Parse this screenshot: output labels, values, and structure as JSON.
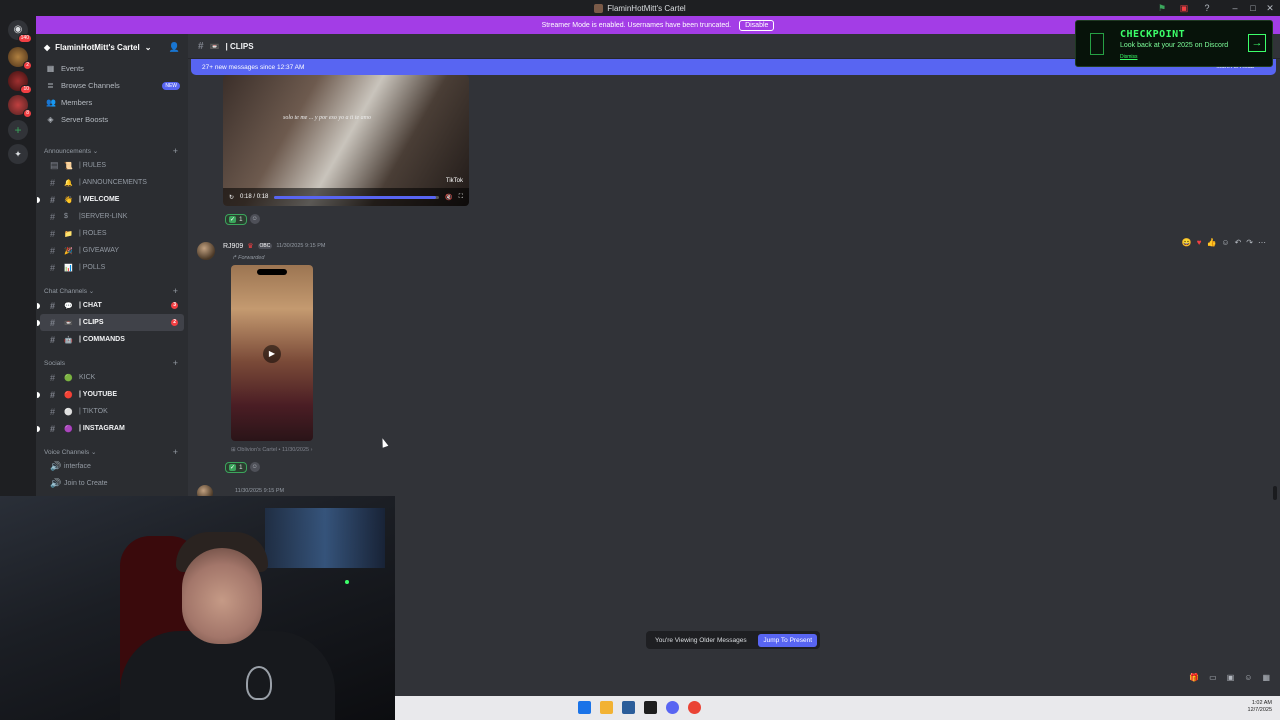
{
  "window": {
    "title": "FlaminHotMitt's Cartel"
  },
  "banner": {
    "text": "Streamer Mode is enabled. Usernames have been truncated.",
    "disable_label": "Disable"
  },
  "rail": {
    "dm_badge": "140",
    "server_badges": [
      "2",
      "10",
      "8"
    ]
  },
  "server": {
    "name": "FlaminHotMitt's Cartel"
  },
  "nav": [
    {
      "label": "Events",
      "icon": "calendar-icon"
    },
    {
      "label": "Browse Channels",
      "icon": "browse-icon",
      "badge": "NEW"
    },
    {
      "label": "Members",
      "icon": "members-icon"
    },
    {
      "label": "Server Boosts",
      "icon": "boost-icon"
    }
  ],
  "categories": [
    {
      "name": "Announcements",
      "channels": [
        {
          "name": "| RULES",
          "emoji": "📜",
          "unread": false
        },
        {
          "name": "| ANNOUNCEMENTS",
          "emoji": "🔔",
          "unread": false
        },
        {
          "name": "| WELCOME",
          "emoji": "👋",
          "unread": true
        },
        {
          "name": "|SERVER-LINK",
          "emoji": "$",
          "unread": false
        },
        {
          "name": "| ROLES",
          "emoji": "📁",
          "unread": false
        },
        {
          "name": "| GIVEAWAY",
          "emoji": "🎉",
          "unread": false
        },
        {
          "name": "| POLLS",
          "emoji": "📊",
          "unread": false
        }
      ]
    },
    {
      "name": "Chat Channels",
      "channels": [
        {
          "name": "| CHAT",
          "emoji": "💬",
          "unread": true,
          "count": "3"
        },
        {
          "name": "| CLIPS",
          "emoji": "📼",
          "unread": true,
          "selected": true,
          "count": "2"
        },
        {
          "name": "| COMMANDS",
          "emoji": "🤖",
          "unread": true
        }
      ]
    },
    {
      "name": "Socials",
      "channels": [
        {
          "name": "KICK",
          "emoji": "🟢",
          "unread": false
        },
        {
          "name": "| YOUTUBE",
          "emoji": "🔴",
          "unread": true
        },
        {
          "name": "| TIKTOK",
          "emoji": "⚪",
          "unread": false
        },
        {
          "name": "| INSTAGRAM",
          "emoji": "🟣",
          "unread": true
        }
      ]
    },
    {
      "name": "Voice Channels",
      "channels": [
        {
          "name": "interface",
          "emoji": "",
          "voice": true,
          "unread": false
        },
        {
          "name": "Join to Create",
          "emoji": "",
          "voice": true,
          "unread": false
        }
      ]
    }
  ],
  "channel_header": {
    "name": "| CLIPS"
  },
  "new_messages": {
    "text": "27+ new messages since 12:37 AM",
    "mark_read": "Mark As Read"
  },
  "video1": {
    "caption": "solo te me ... y por eso yo a ti te amo",
    "time": "0:18 / 0:18",
    "progress": 0.98,
    "watermark": "TikTok"
  },
  "reactions1": {
    "count": "1"
  },
  "message2": {
    "author": "RJ909",
    "tag": "OBC",
    "timestamp": "11/30/2025 9:15 PM",
    "forwarded": "Forwarded",
    "source": "Oblivion's Cartel  •  11/30/2025",
    "reaction_count": "1"
  },
  "message3": {
    "timestamp": "11/30/2025 9:15 PM"
  },
  "older_bar": {
    "text": "You're Viewing Older Messages",
    "jump": "Jump To Present"
  },
  "toast": {
    "title": "CHECKPOINT",
    "subtitle": "Look back at your 2025 on Discord",
    "link": "Dismiss"
  },
  "clock": {
    "time": "1:02 AM",
    "date": "12/7/2025"
  },
  "colors": {
    "blurple": "#5865f2",
    "banner": "#a33de6",
    "green": "#3cff6a"
  }
}
